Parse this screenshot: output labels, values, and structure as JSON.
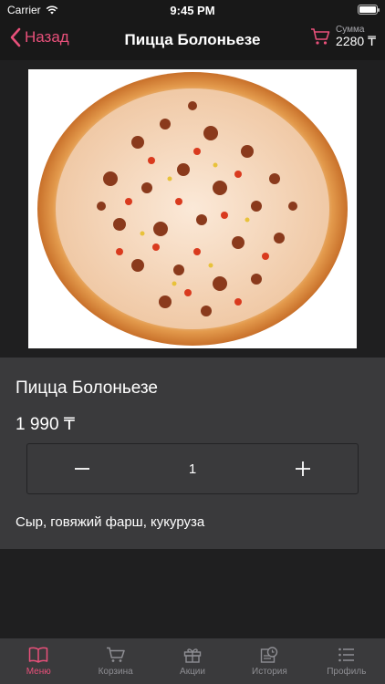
{
  "status_bar": {
    "carrier": "Carrier",
    "time": "9:45 PM"
  },
  "nav": {
    "back_label": "Назад",
    "title": "Пицца Болоньезе",
    "cart_label": "Сумма",
    "cart_amount": "2280 ₸"
  },
  "product": {
    "image_icon": "pizza-photo",
    "name": "Пицца Болоньезе",
    "price": "1 990 ₸",
    "quantity": 1,
    "description": "Сыр, говяжий фарш, кукуруза"
  },
  "tabs": [
    {
      "label": "Меню",
      "icon": "book-icon",
      "active": true
    },
    {
      "label": "Корзина",
      "icon": "cart-icon",
      "active": false
    },
    {
      "label": "Акции",
      "icon": "gift-icon",
      "active": false
    },
    {
      "label": "История",
      "icon": "history-icon",
      "active": false
    },
    {
      "label": "Профиль",
      "icon": "list-icon",
      "active": false
    }
  ],
  "colors": {
    "accent": "#e8507a",
    "background": "#1f1f20",
    "card": "#3a3a3c",
    "tab_inactive": "#8e8e93"
  }
}
